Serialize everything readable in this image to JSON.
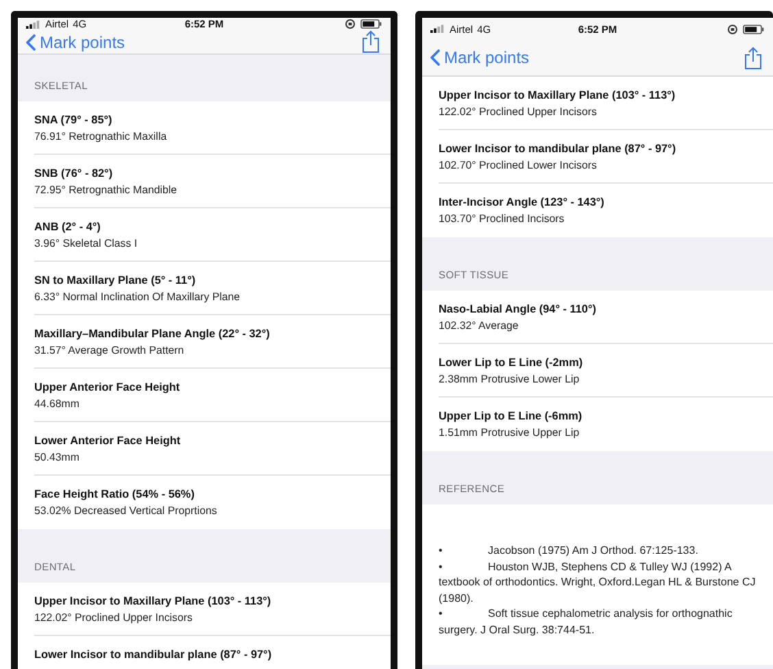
{
  "phones": [
    {
      "status_bar": {
        "carrier": "Airtel",
        "network": "4G",
        "time": "6:52 PM"
      },
      "nav_bar": {
        "back_label": "Mark points"
      },
      "sections": [
        {
          "title": "SKELETAL",
          "items": [
            {
              "kind": "measurement",
              "title": "SNA (79° - 85°)",
              "value": "76.91° Retrognathic Maxilla"
            },
            {
              "kind": "measurement",
              "title": "SNB (76° - 82°)",
              "value": "72.95° Retrognathic Mandible"
            },
            {
              "kind": "measurement",
              "title": "ANB (2° - 4°)",
              "value": "3.96° Skeletal Class I"
            },
            {
              "kind": "measurement",
              "title": "SN to Maxillary Plane (5° - 11°)",
              "value": "6.33° Normal Inclination Of Maxillary Plane"
            },
            {
              "kind": "measurement",
              "title": "Maxillary–Mandibular Plane Angle (22° - 32°)",
              "value": "31.57° Average Growth Pattern"
            },
            {
              "kind": "measurement",
              "title": "Upper Anterior Face Height",
              "value": "44.68mm"
            },
            {
              "kind": "measurement",
              "title": "Lower Anterior Face Height",
              "value": "50.43mm"
            },
            {
              "kind": "measurement",
              "title": "Face Height Ratio (54% - 56%)",
              "value": "53.02% Decreased Vertical Proprtions"
            }
          ]
        },
        {
          "title": "DENTAL",
          "items": [
            {
              "kind": "measurement",
              "title": "Upper Incisor to Maxillary Plane (103° - 113°)",
              "value": "122.02° Proclined Upper Incisors"
            },
            {
              "kind": "measurement",
              "title": "Lower Incisor to mandibular plane (87° - 97°)"
            }
          ]
        }
      ]
    },
    {
      "status_bar": {
        "carrier": "Airtel",
        "network": "4G",
        "time": "6:52 PM"
      },
      "nav_bar": {
        "back_label": "Mark points"
      },
      "sections": [
        {
          "items": [
            {
              "kind": "measurement",
              "title": "Upper Incisor to Maxillary Plane (103° - 113°)",
              "value": "122.02° Proclined Upper Incisors"
            },
            {
              "kind": "measurement",
              "title": "Lower Incisor to mandibular plane (87° - 97°)",
              "value": "102.70° Proclined Lower Incisors"
            },
            {
              "kind": "measurement",
              "title": "Inter-Incisor Angle (123° - 143°)",
              "value": "103.70° Proclined Incisors"
            }
          ]
        },
        {
          "title": "SOFT TISSUE",
          "items": [
            {
              "kind": "measurement",
              "title": "Naso-Labial Angle (94° - 110°)",
              "value": "102.32° Average"
            },
            {
              "kind": "measurement",
              "title": "Lower Lip to E Line (-2mm)",
              "value": "2.38mm Protrusive Lower Lip"
            },
            {
              "kind": "measurement",
              "title": "Upper Lip to E Line (-6mm)",
              "value": "1.51mm Protrusive Upper Lip"
            }
          ]
        },
        {
          "title": "REFERENCE",
          "items": [
            {
              "kind": "reference",
              "entries": [
                "•\tJacobson (1975) Am J Orthod. 67:125-133.",
                "•\tHouston WJB, Stephens CD & Tulley WJ (1992) A textbook of orthodontics. Wright, Oxford.Legan HL & Burstone CJ (1980).",
                "•\tSoft tissue cephalometric analysis for orthognathic surgery. J Oral Surg. 38:744-51."
              ]
            }
          ]
        }
      ]
    }
  ]
}
